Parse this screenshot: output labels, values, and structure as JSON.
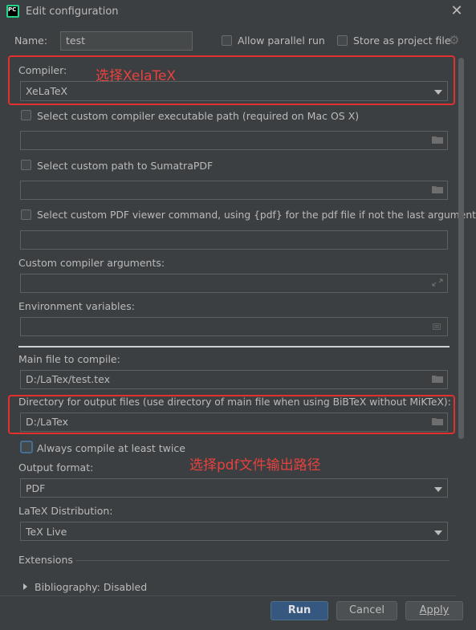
{
  "window": {
    "title": "Edit configuration",
    "app_icon_text": "PC"
  },
  "header": {
    "name_label": "Name:",
    "name_value": "test",
    "allow_parallel_label": "Allow parallel run",
    "store_project_label": "Store as project file"
  },
  "compiler": {
    "label": "Compiler:",
    "value": "XeLaTeX",
    "note": "选择XelaTeX"
  },
  "custom_compiler_path": {
    "label": "Select custom compiler executable path (required on Mac OS X)",
    "value": ""
  },
  "sumatra": {
    "label": "Select custom path to SumatraPDF",
    "value": ""
  },
  "pdf_viewer": {
    "label": "Select custom PDF viewer command, using {pdf} for the pdf file if not the last argument",
    "value": ""
  },
  "compiler_args": {
    "label": "Custom compiler arguments:",
    "value": ""
  },
  "env_vars": {
    "label": "Environment variables:",
    "value": ""
  },
  "main_file": {
    "label": "Main file to compile:",
    "value": "D:/LaTex/test.tex"
  },
  "output_dir": {
    "label": "Directory for output files (use directory of main file when using BiBTeX without MiKTeX):",
    "value": "D:/LaTex",
    "note": "选择pdf文件输出路径"
  },
  "compile_twice": {
    "label": "Always compile at least twice"
  },
  "output_format": {
    "label": "Output format:",
    "value": "PDF"
  },
  "distribution": {
    "label": "LaTeX Distribution:",
    "value": "TeX Live"
  },
  "extensions": {
    "label": "Extensions",
    "bibliography": "Bibliography: Disabled"
  },
  "buttons": {
    "run": "Run",
    "cancel": "Cancel",
    "apply": "Apply"
  },
  "colors": {
    "background": "#3c3f41",
    "annotation": "#e0312f",
    "primary_button": "#365880"
  }
}
